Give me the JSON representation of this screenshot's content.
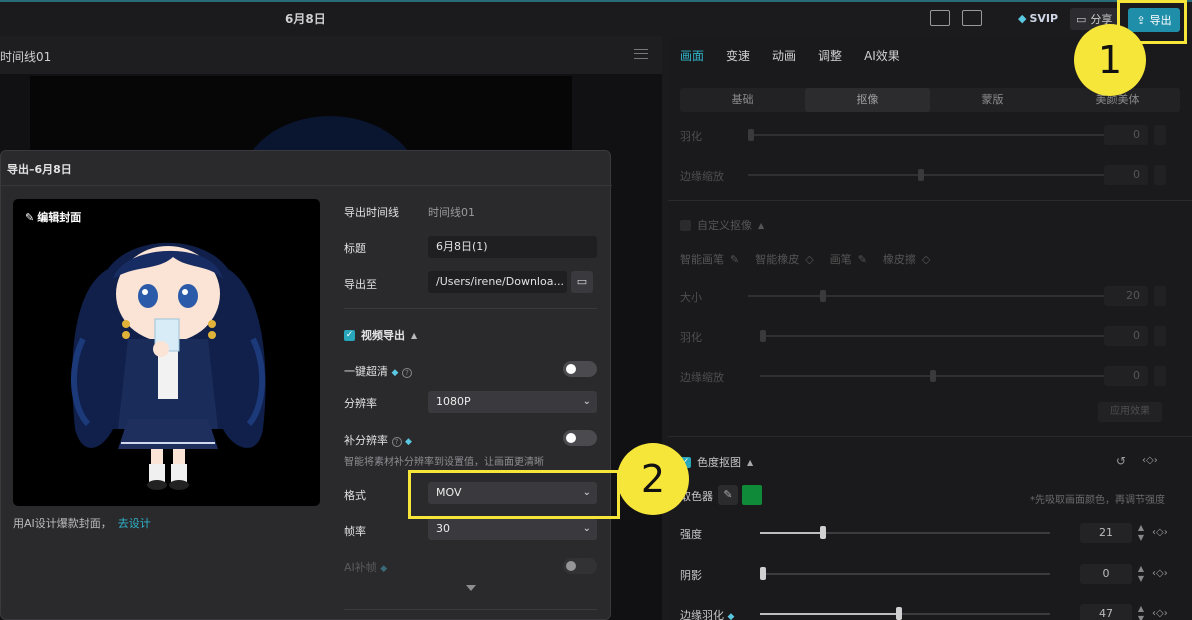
{
  "topbar": {
    "date": "6月8日",
    "svip_label": "SVIP",
    "share_label": "分享",
    "export_label": "导出"
  },
  "player": {
    "title": "时间线01"
  },
  "right_panel": {
    "tabs": [
      "画面",
      "变速",
      "动画",
      "调整",
      "AI效果"
    ],
    "subtabs": [
      "基础",
      "抠像",
      "蒙版",
      "美颜美体"
    ],
    "feather_label": "羽化",
    "feather_value": "0",
    "edge_shrink_label": "边缘缩放",
    "edge_shrink_value": "0",
    "custom_matting_label": "自定义抠像",
    "smart_brush": "智能画笔",
    "smart_eraser": "智能橡皮",
    "brush": "画笔",
    "eraser": "橡皮擦",
    "size_label": "大小",
    "size_value": "20",
    "feather2_label": "羽化",
    "feather2_value": "0",
    "edge2_label": "边缘缩放",
    "edge2_value": "0",
    "apply_effect": "应用效果",
    "chroma_label": "色度抠图",
    "picker_label": "取色器",
    "picker_hint": "*先吸取画面颜色，再调节强度",
    "picker_color": "#0f8a38",
    "intensity_label": "强度",
    "intensity_value": "21",
    "shadow_label": "阴影",
    "shadow_value": "0",
    "edge_feather_label": "边缘羽化",
    "edge_feather_value": "47"
  },
  "dialog": {
    "title": "导出–6月8日",
    "edit_cover": "编辑封面",
    "ai_design_text": "用AI设计爆款封面，",
    "ai_design_link": "去设计",
    "timeline_label": "导出时间线",
    "timeline_value": "时间线01",
    "title_label": "标题",
    "title_value": "6月8日(1)",
    "export_to_label": "导出至",
    "export_to_value": "/Users/irene/Downloa...",
    "video_export_label": "视频导出",
    "super_clear_label": "一键超清",
    "resolution_label": "分辨率",
    "resolution_value": "1080P",
    "supplement_res_label": "补分辨率",
    "supplement_hint": "智能将素材补分辨率到设置值，让画面更清晰",
    "format_label": "格式",
    "format_value": "MOV",
    "framerate_label": "帧率",
    "framerate_value": "30",
    "ai_frame_label": "AI补帧"
  },
  "annotations": {
    "badge1": "1",
    "badge2": "2",
    "highlight_color": "#f7e63a"
  }
}
